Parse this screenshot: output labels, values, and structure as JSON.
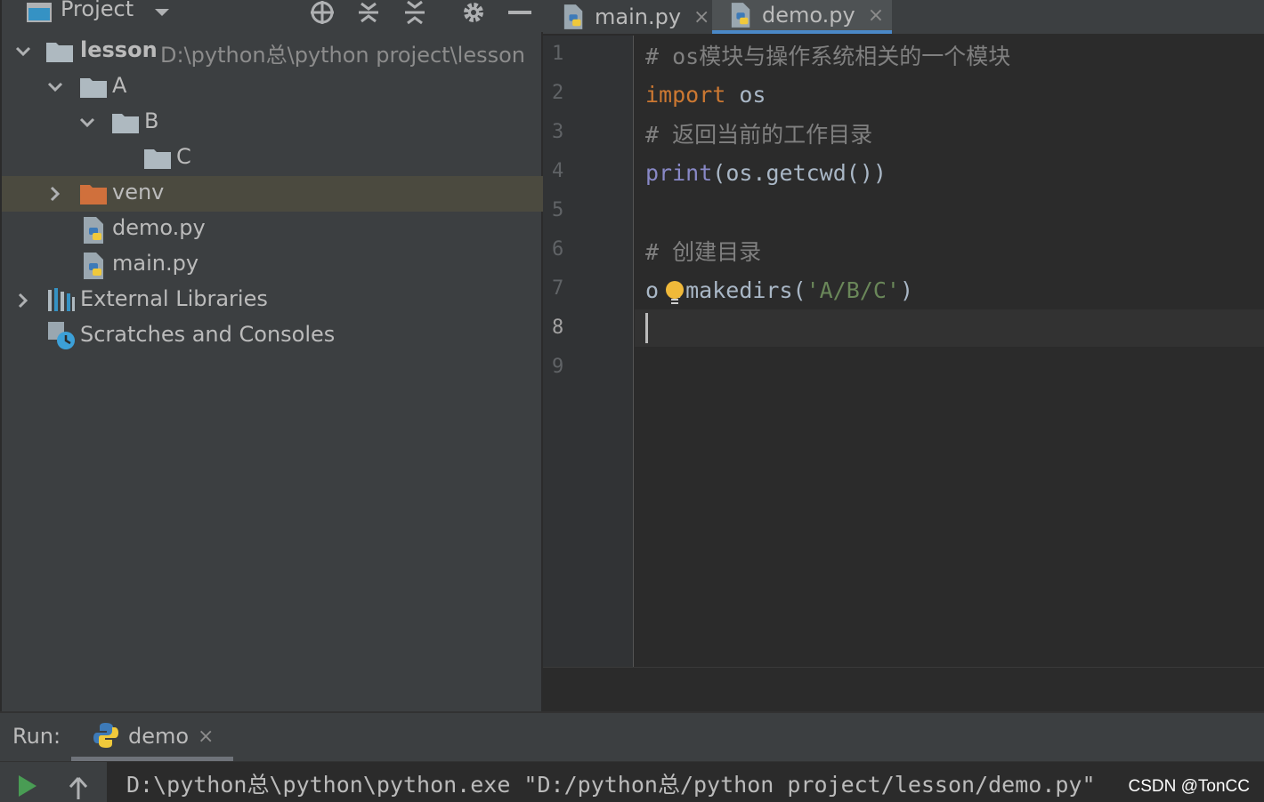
{
  "project_panel": {
    "title": "Project",
    "tree": [
      {
        "label": "lesson",
        "path": "D:\\python总\\python project\\lesson",
        "type": "folder",
        "expanded": true
      },
      {
        "label": "A",
        "type": "folder",
        "expanded": true
      },
      {
        "label": "B",
        "type": "folder",
        "expanded": true
      },
      {
        "label": "C",
        "type": "folder"
      },
      {
        "label": "venv",
        "type": "folder-excluded",
        "expanded": false,
        "selected": true
      },
      {
        "label": "demo.py",
        "type": "python-file"
      },
      {
        "label": "main.py",
        "type": "python-file"
      },
      {
        "label": "External Libraries",
        "type": "libraries",
        "expanded": false
      },
      {
        "label": "Scratches and Consoles",
        "type": "scratches"
      }
    ]
  },
  "editor": {
    "tabs": [
      {
        "label": "main.py",
        "active": false,
        "close": "×"
      },
      {
        "label": "demo.py",
        "active": true,
        "close": "×"
      }
    ],
    "line_numbers": [
      "1",
      "2",
      "3",
      "4",
      "5",
      "6",
      "7",
      "8",
      "9"
    ],
    "current_line": "8",
    "code": {
      "l1_comment": "# os模块与操作系统相关的一个模块",
      "l2_kw": "import",
      "l2_rest": " os",
      "l3_comment": "# 返回当前的工作目录",
      "l4_fn": "print",
      "l4_rest": "(os.getcwd())",
      "l6_comment": "# 创建目录",
      "l7_a": "o",
      "l7_b": ".makedirs(",
      "l7_str": "'A/B/C'",
      "l7_c": ")"
    }
  },
  "run_panel": {
    "label": "Run:",
    "tab_label": "demo",
    "tab_close": "×",
    "console_line": "D:\\python总\\python\\python.exe \"D:/python总/python project/lesson/demo.py\""
  },
  "watermark": "CSDN @TonCC",
  "colors": {
    "background": "#2b2b2b",
    "panel": "#3c3f41",
    "keyword": "#cc7832",
    "builtin": "#8888c6",
    "string": "#6a8759",
    "comment": "#808080",
    "tab_underline": "#4a88c7",
    "selection": "#4b4a3f"
  }
}
